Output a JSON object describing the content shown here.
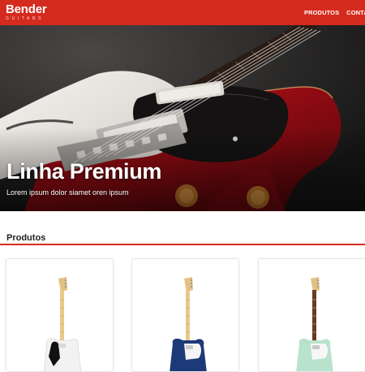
{
  "header": {
    "brand": "Bender",
    "brand_tagline": "GUITARS",
    "nav": [
      {
        "label": "PRODUTOS"
      },
      {
        "label": "CONTATO"
      }
    ],
    "colors": {
      "accent": "#d52b1e"
    }
  },
  "hero": {
    "title": "Linha Premium",
    "subtitle": "Lorem ipsum dolor siamet oren ipsum",
    "image": "red-guitar-photo"
  },
  "products": {
    "heading": "Produtos",
    "items": [
      {
        "image": "black-telecaster-guitar",
        "body_color": "#f2f2f2",
        "guard_color": "#111111",
        "neck_color": "#e8c98a"
      },
      {
        "image": "blue-telecaster-guitar",
        "body_color": "#1d3a78",
        "guard_color": "#f4f4f4",
        "neck_color": "#e8c98a"
      },
      {
        "image": "mint-telecaster-guitar",
        "body_color": "#b9e2cd",
        "guard_color": "#f7f7f7",
        "neck_color": "#6b3b23"
      }
    ]
  }
}
